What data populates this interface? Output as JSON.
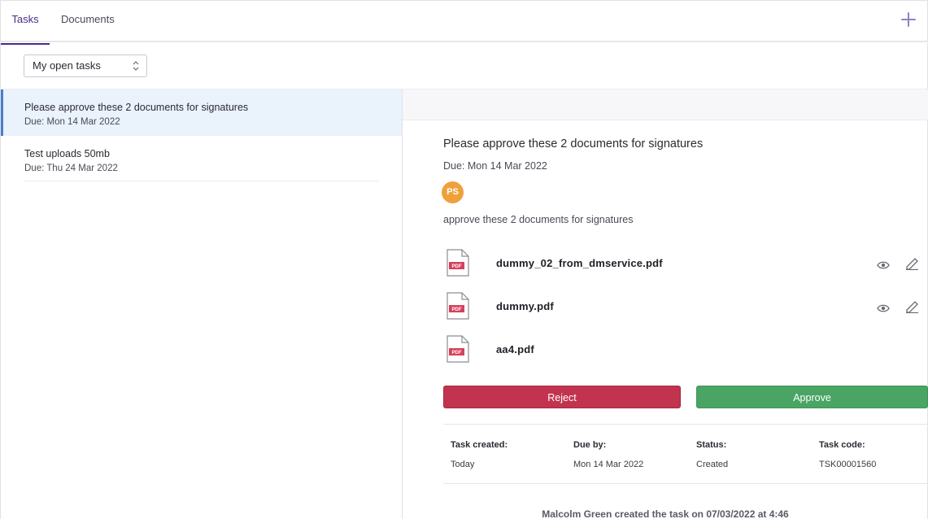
{
  "tabs": [
    {
      "label": "Tasks",
      "active": true
    },
    {
      "label": "Documents",
      "active": false
    }
  ],
  "add_icon": "plus-icon",
  "filter": {
    "selected": "My open tasks"
  },
  "tasks": [
    {
      "title": "Please approve these 2 documents for signatures",
      "due": "Due: Mon 14 Mar 2022",
      "active": true
    },
    {
      "title": "Test uploads 50mb",
      "due": "Due: Thu 24 Mar 2022",
      "active": false
    }
  ],
  "detail": {
    "title": "Please approve these 2 documents for signatures",
    "due": "Due: Mon 14 Mar 2022",
    "avatar_initials": "PS",
    "description": "approve these 2 documents for signatures",
    "documents": [
      {
        "name": "dummy_02_from_dmservice.pdf",
        "icon": "pdf-file-icon",
        "actions": [
          "view",
          "edit"
        ]
      },
      {
        "name": "dummy.pdf",
        "icon": "pdf-file-icon",
        "actions": [
          "view",
          "edit"
        ]
      },
      {
        "name": "aa4.pdf",
        "icon": "pdf-file-icon",
        "actions": []
      }
    ],
    "pdf_badge": "PDF",
    "reject_label": "Reject",
    "approve_label": "Approve",
    "meta": {
      "created_label": "Task created:",
      "created_value": "Today",
      "due_label": "Due by:",
      "due_value": "Mon 14 Mar 2022",
      "status_label": "Status:",
      "status_value": "Created",
      "code_label": "Task code:",
      "code_value": "TSK00001560"
    },
    "activity": "Malcolm Green created the task on 07/03/2022 at 4:46"
  },
  "colors": {
    "accent": "#4b2a86",
    "active_row": "#eaf2fc",
    "reject": "#c2334f",
    "approve": "#4aa464",
    "avatar": "#f0a03a",
    "pdf_badge": "#d6405a"
  }
}
